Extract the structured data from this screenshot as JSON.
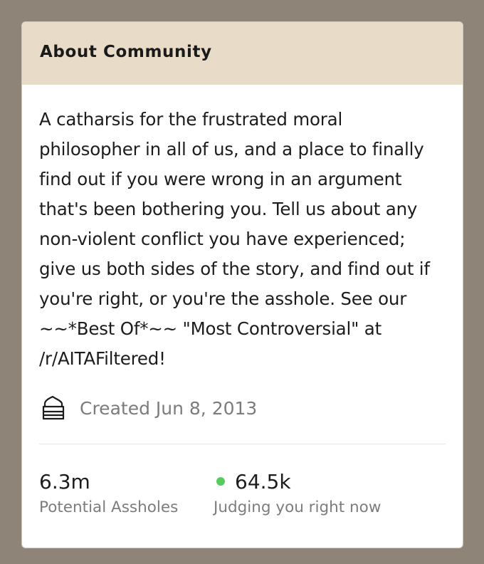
{
  "colors": {
    "page_background": "#8e8477",
    "header_background": "#e8dcc9",
    "online_dot": "#56cc5e"
  },
  "widget": {
    "title": "About Community",
    "description": "A catharsis for the frustrated moral philosopher in all of us, and a place to finally find out if you were wrong in an argument that's been bothering you. Tell us about any non-violent conflict you have experienced; give us both sides of the story, and find out if you're right, or you're the asshole. See our ~~*Best Of*~~ \"Most Controversial\" at /r/AITAFiltered!",
    "created": {
      "icon": "cake-icon",
      "text": "Created Jun 8, 2013"
    },
    "stats": {
      "members": {
        "value": "6.3m",
        "label": "Potential Assholes"
      },
      "online": {
        "icon": "online-dot",
        "value": "64.5k",
        "label": "Judging you right now"
      }
    }
  }
}
